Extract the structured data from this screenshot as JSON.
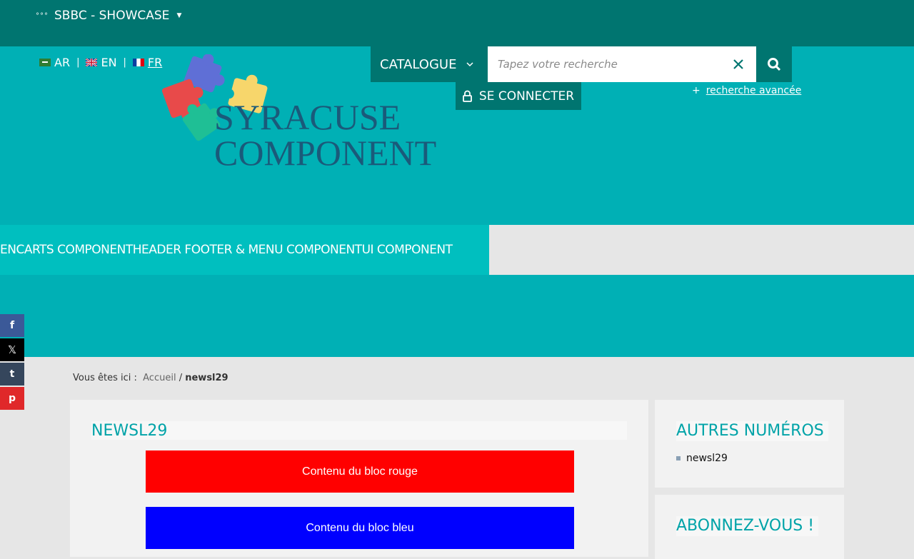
{
  "topbar": {
    "site_switcher": "SBBC - SHOWCASE"
  },
  "languages": [
    {
      "code": "AR"
    },
    {
      "code": "EN"
    },
    {
      "code": "FR"
    }
  ],
  "logo": {
    "line1": "SYRACUSE",
    "line2": "COMPONENT"
  },
  "catalogue_label": "CATALOGUE",
  "search": {
    "placeholder": "Tapez votre recherche",
    "value": ""
  },
  "login_label": "SE CONNECTER",
  "advanced_search": {
    "plus": "+",
    "label": "recherche avancée"
  },
  "nav": {
    "items": [
      {
        "label": "ENCARTS COMPONENT"
      },
      {
        "label": "HEADER FOOTER & MENU COMPONENT"
      },
      {
        "label": "UI COMPONENT"
      }
    ]
  },
  "social": [
    {
      "icon": "facebook-icon",
      "glyph": "f",
      "color": "#3b5998"
    },
    {
      "icon": "x-icon",
      "glyph": "𝕏",
      "color": "#000000"
    },
    {
      "icon": "tumblr-icon",
      "glyph": "t",
      "color": "#35465c"
    },
    {
      "icon": "pinterest-icon",
      "glyph": "p",
      "color": "#e0282a"
    }
  ],
  "breadcrumb": {
    "prefix": "Vous êtes ici :",
    "home": "Accueil",
    "sep": "/",
    "current": "newsl29"
  },
  "main": {
    "title": "NEWSL29",
    "red_block": "Contenu du bloc rouge",
    "blue_block": "Contenu du bloc bleu"
  },
  "sidebar": {
    "other_issues_title": "AUTRES NUMÉROS",
    "other_issues": [
      {
        "label": "newsl29"
      }
    ],
    "subscribe_title": "ABONNEZ-VOUS !"
  },
  "colors": {
    "topbar": "#007570",
    "header": "#00b0b5",
    "nav": "#00bfbf",
    "accent_text": "#00a3a8",
    "logo_text": "#1a5a7a"
  }
}
